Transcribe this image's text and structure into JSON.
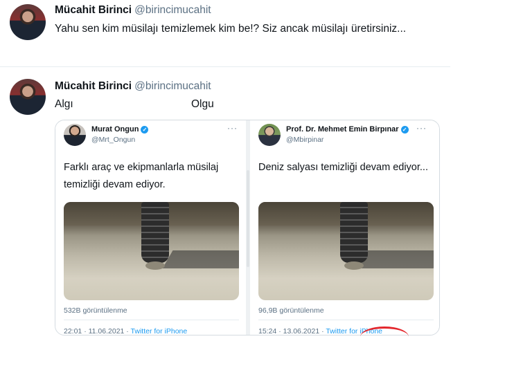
{
  "tweet1": {
    "name": "Mücahit Birinci",
    "handle": "@birincimucahit",
    "text": "Yahu sen kim müsilajı temizlemek kim be!? Siz ancak müsilajı üretirsiniz..."
  },
  "tweet2": {
    "name": "Mücahit Birinci",
    "handle": "@birincimucahit",
    "text_left": "Algı",
    "text_right": "Olgu",
    "embedded": {
      "left": {
        "name": "Murat Ongun",
        "handle": "@Mrt_Ongun",
        "text": "Farklı araç ve ekipmanlarla müsilaj temizliği devam ediyor.",
        "views": "532B görüntülenme",
        "time": "22:01 · 11.06.2021 ·",
        "source": "Twitter for iPhone",
        "more": "···"
      },
      "right": {
        "name": "Prof. Dr. Mehmet Emin Birpınar",
        "handle": "@Mbirpinar",
        "text": "Deniz salyası temizliği devam ediyor...",
        "views": "96,9B görüntülenme",
        "time": "15:24 · 13.06.2021 ·",
        "source": "Twitter for iPhone",
        "more": "···"
      }
    }
  },
  "colors": {
    "text": "#0f1419",
    "secondary": "#5b7083",
    "accent": "#1d9bf0",
    "divider": "#e6ecf0",
    "annotation": "#e3262c"
  },
  "icons": {
    "verified": "verified-badge-icon",
    "more": "more-options-icon"
  }
}
